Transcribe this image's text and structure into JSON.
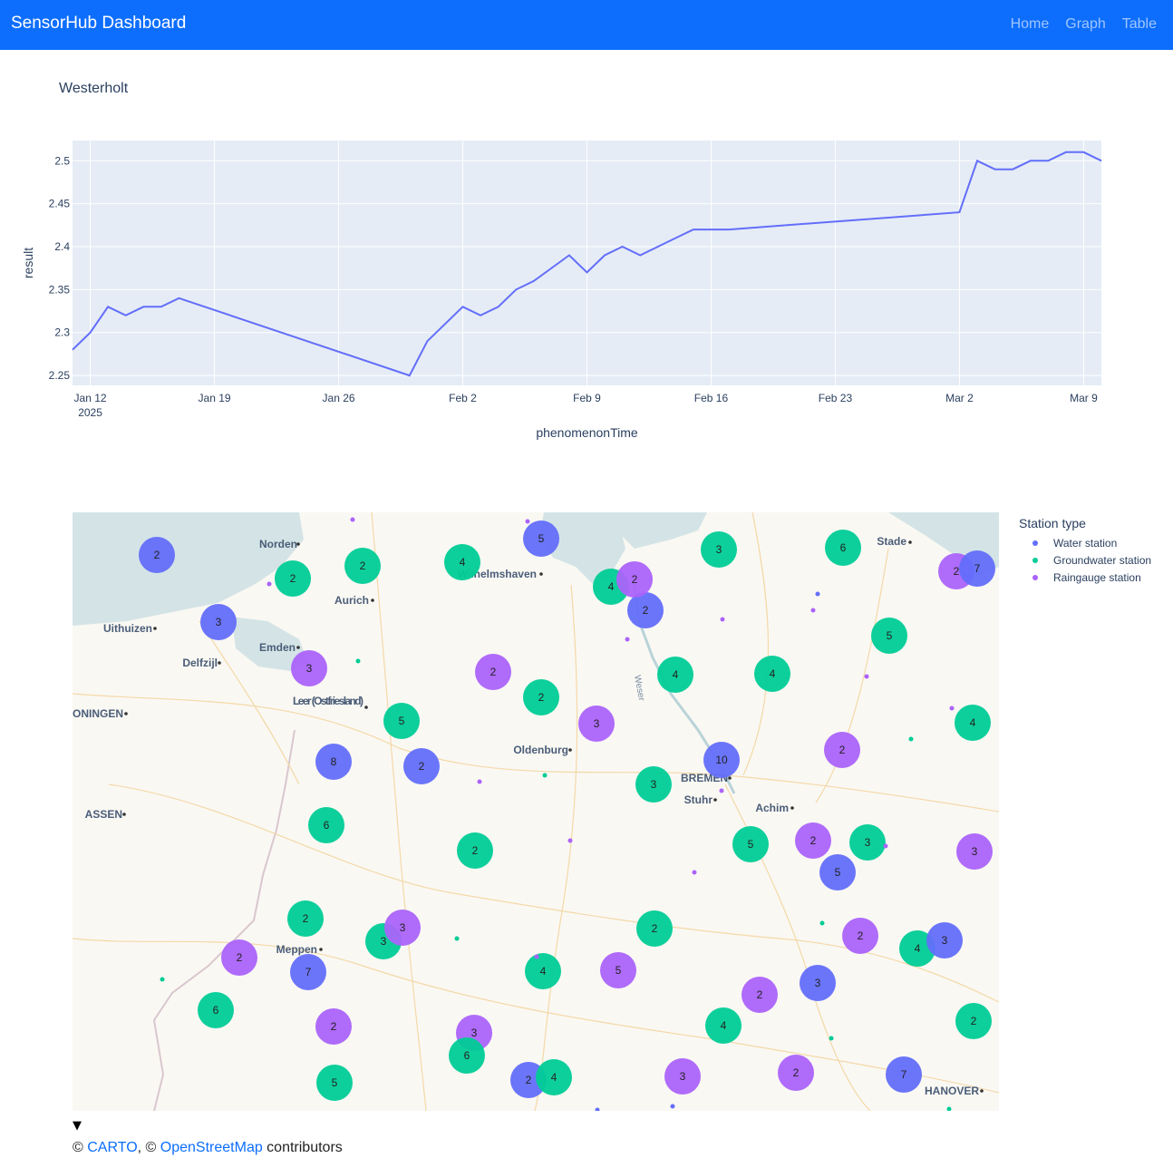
{
  "navbar": {
    "brand": "SensorHub Dashboard",
    "links": [
      "Home",
      "Graph",
      "Table"
    ]
  },
  "colors": {
    "navbar": "#0d6efd",
    "line": "#636efa",
    "plot_bg": "#e5ecf6",
    "water": "#636efa",
    "groundwater": "#00cc96",
    "raingauge": "#ab63fa"
  },
  "chart_data": {
    "type": "line",
    "title": "Westerholt",
    "xlabel": "phenomenonTime",
    "ylabel": "result",
    "x_ticks": [
      "Jan 12",
      "Jan 19",
      "Jan 26",
      "Feb 2",
      "Feb 9",
      "Feb 16",
      "Feb 23",
      "Mar 2",
      "Mar 9"
    ],
    "x_tick_year": "2025",
    "y_ticks": [
      "2.25",
      "2.3",
      "2.35",
      "2.4",
      "2.45",
      "2.5"
    ],
    "ylim": [
      2.2385,
      2.5235
    ],
    "xlim": [
      "2025-01-11",
      "2025-03-10"
    ],
    "grid": true,
    "series": [
      {
        "x": [
          "2025-01-11",
          "2025-01-12",
          "2025-01-13",
          "2025-01-14",
          "2025-01-15",
          "2025-01-16",
          "2025-01-17",
          "2025-01-30",
          "2025-01-31",
          "2025-02-01",
          "2025-02-02",
          "2025-02-03",
          "2025-02-04",
          "2025-02-05",
          "2025-02-06",
          "2025-02-08",
          "2025-02-09",
          "2025-02-10",
          "2025-02-11",
          "2025-02-12",
          "2025-02-13",
          "2025-02-14",
          "2025-02-15",
          "2025-02-16",
          "2025-02-17",
          "2025-03-02",
          "2025-03-03",
          "2025-03-04",
          "2025-03-05",
          "2025-03-06",
          "2025-03-07",
          "2025-03-08",
          "2025-03-09",
          "2025-03-10"
        ],
        "y": [
          2.28,
          2.3,
          2.33,
          2.32,
          2.33,
          2.33,
          2.34,
          2.25,
          2.29,
          2.31,
          2.33,
          2.32,
          2.33,
          2.35,
          2.36,
          2.39,
          2.37,
          2.39,
          2.4,
          2.39,
          2.4,
          2.41,
          2.42,
          2.42,
          2.42,
          2.44,
          2.5,
          2.49,
          2.49,
          2.5,
          2.5,
          2.51,
          2.51,
          2.5
        ]
      }
    ]
  },
  "map": {
    "legend_title": "Station type",
    "legend_items": [
      {
        "label": "Water station",
        "color": "#636efa"
      },
      {
        "label": "Groundwater station",
        "color": "#00cc96"
      },
      {
        "label": "Raingauge station",
        "color": "#ab63fa"
      }
    ],
    "cities": [
      "Norden",
      "Aurich",
      "Wilhelmshaven",
      "Stade",
      "Uithuizen",
      "Emden",
      "Delfzijl",
      "Leer (Ostfriesland)",
      "ONINGEN",
      "Oldenburg",
      "BREMEN",
      "Stuhr",
      "Achim",
      "ASSEN",
      "Meppen",
      "HANOVER",
      "Weser"
    ],
    "cluster_counts": [
      "2",
      "5",
      "4",
      "2",
      "2",
      "3",
      "6",
      "2",
      "7",
      "3",
      "4",
      "2",
      "5",
      "2",
      "3",
      "2",
      "2",
      "4",
      "4",
      "5",
      "10",
      "3",
      "8",
      "2",
      "2",
      "4",
      "3",
      "6",
      "2",
      "5",
      "3",
      "5",
      "2",
      "3",
      "2",
      "3",
      "7",
      "2",
      "3",
      "2",
      "4",
      "5",
      "2",
      "4",
      "3",
      "3",
      "2",
      "6",
      "2",
      "4",
      "2",
      "3",
      "6",
      "3",
      "5",
      "2",
      "4",
      "2",
      "7"
    ]
  },
  "toggle": "▼",
  "attribution": {
    "prefix": "© ",
    "carto": "CARTO",
    "middle": ", © ",
    "osm": "OpenStreetMap",
    "suffix": " contributors"
  }
}
